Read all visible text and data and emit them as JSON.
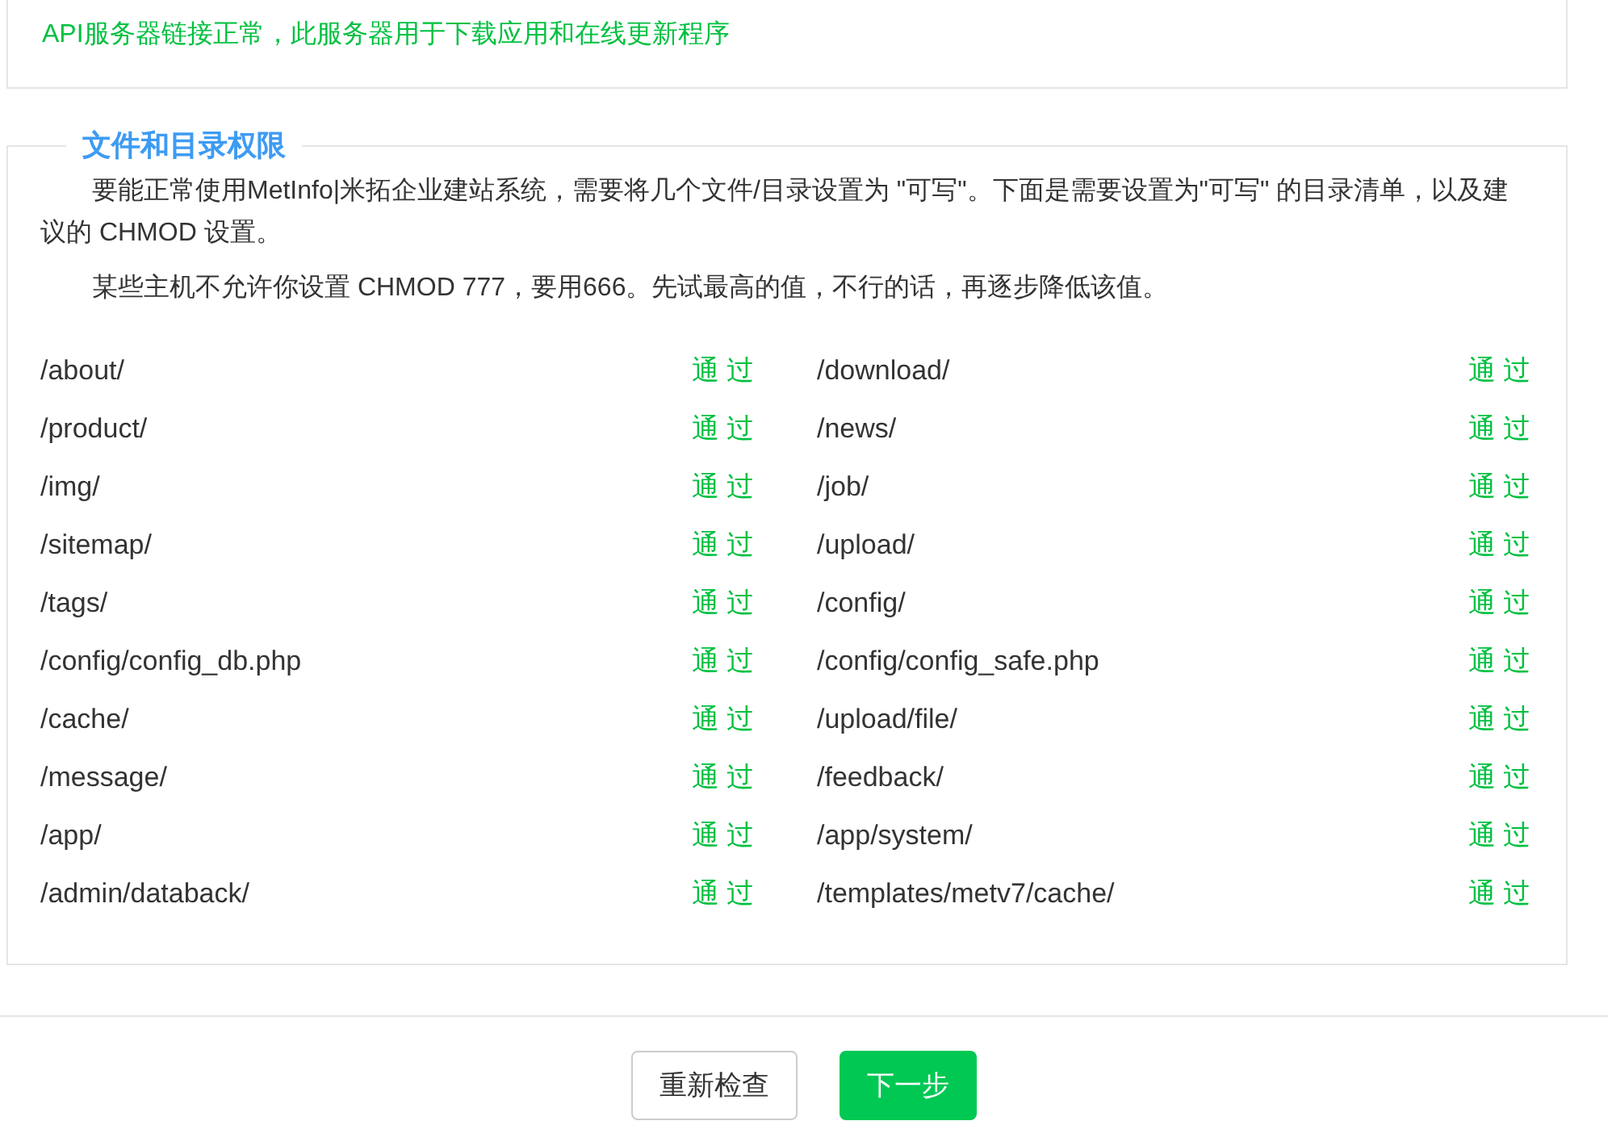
{
  "api_status": {
    "text": "API服务器链接正常，此服务器用于下载应用和在线更新程序",
    "ok": true
  },
  "permissions": {
    "title": "文件和目录权限",
    "paragraphs": [
      "要能正常使用MetInfo|米拓企业建站系统，需要将几个文件/目录设置为 \"可写\"。下面是需要设置为\"可写\" 的目录清单，以及建议的 CHMOD 设置。",
      "某些主机不允许你设置 CHMOD 777，要用666。先试最高的值，不行的话，再逐步降低该值。"
    ],
    "items": [
      {
        "path": "/about/",
        "status": "通 过",
        "passed": true
      },
      {
        "path": "/download/",
        "status": "通 过",
        "passed": true
      },
      {
        "path": "/product/",
        "status": "通 过",
        "passed": true
      },
      {
        "path": "/news/",
        "status": "通 过",
        "passed": true
      },
      {
        "path": "/img/",
        "status": "通 过",
        "passed": true
      },
      {
        "path": "/job/",
        "status": "通 过",
        "passed": true
      },
      {
        "path": "/sitemap/",
        "status": "通 过",
        "passed": true
      },
      {
        "path": "/upload/",
        "status": "通 过",
        "passed": true
      },
      {
        "path": "/tags/",
        "status": "通 过",
        "passed": true
      },
      {
        "path": "/config/",
        "status": "通 过",
        "passed": true
      },
      {
        "path": "/config/config_db.php",
        "status": "通 过",
        "passed": true
      },
      {
        "path": "/config/config_safe.php",
        "status": "通 过",
        "passed": true
      },
      {
        "path": "/cache/",
        "status": "通 过",
        "passed": true
      },
      {
        "path": "/upload/file/",
        "status": "通 过",
        "passed": true
      },
      {
        "path": "/message/",
        "status": "通 过",
        "passed": true
      },
      {
        "path": "/feedback/",
        "status": "通 过",
        "passed": true
      },
      {
        "path": "/app/",
        "status": "通 过",
        "passed": true
      },
      {
        "path": "/app/system/",
        "status": "通 过",
        "passed": true
      },
      {
        "path": "/admin/databack/",
        "status": "通 过",
        "passed": true
      },
      {
        "path": "/templates/metv7/cache/",
        "status": "通 过",
        "passed": true
      }
    ]
  },
  "buttons": [
    {
      "label": "重新检查",
      "kind": "secondary"
    },
    {
      "label": "下一步",
      "kind": "primary"
    }
  ]
}
